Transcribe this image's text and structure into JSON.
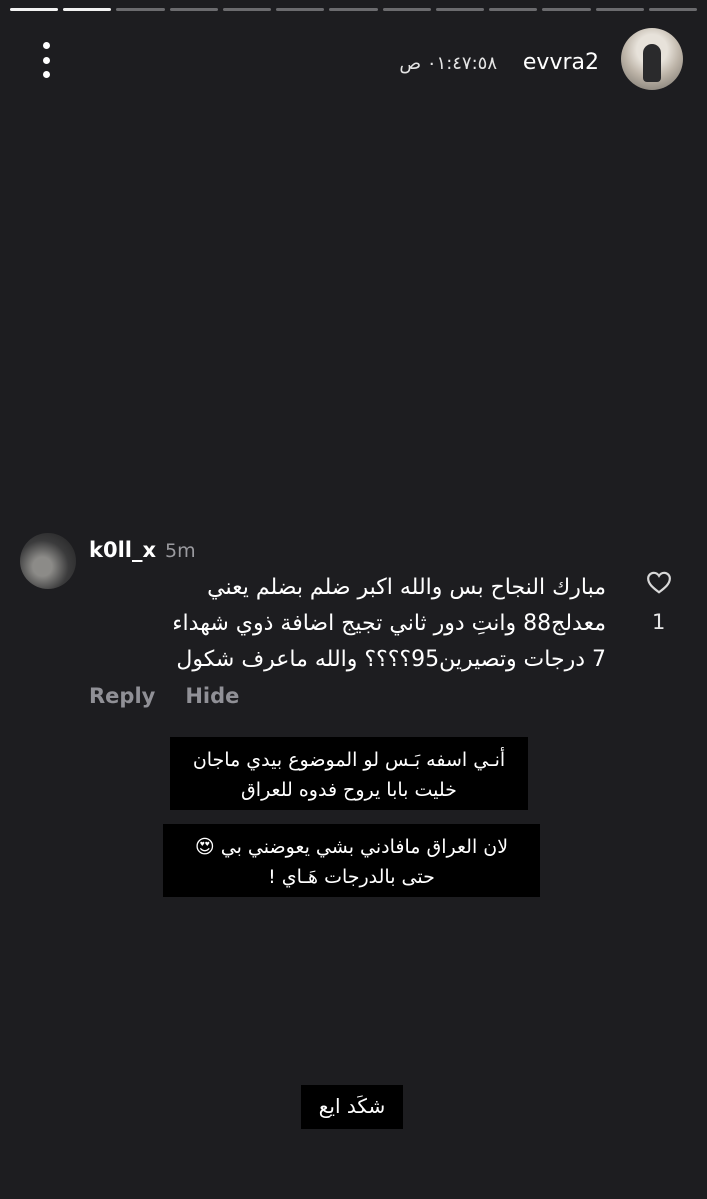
{
  "story": {
    "progress_segments": 13,
    "active_segments": 2,
    "username": "evvra2",
    "timestamp": "٠١:٤٧:٥٨ ص",
    "menu_icon": "more-vertical-icon"
  },
  "comment": {
    "username": "k0ll_x",
    "time": "5m",
    "text_lines": [
      "مبارك النجاح بس والله اكبر ضلم بضلم يعني",
      "معدلج88 وانتِ دور ثاني تجيج اضافة ذوي شهداء",
      "7 درجات وتصيرين95؟؟؟؟ والله ماعرف شكول"
    ],
    "reply_label": "Reply",
    "hide_label": "Hide",
    "likes": "1",
    "like_icon": "heart-icon"
  },
  "captions": [
    {
      "lines": [
        "أنـي اسفه بَـس لو الموضوع بيدي ماجان",
        "خليت بابا يروح فدوه للعراق"
      ]
    },
    {
      "lines": [
        "لان العراق مافادني بشي يعوضني بي 😍",
        "حتى بالدرجات هَـاي !"
      ]
    },
    {
      "lines": [
        "شكَد ايع"
      ]
    }
  ],
  "colors": {
    "background": "#1d1d20",
    "caption_bg": "#000000",
    "muted_text": "#909096"
  }
}
